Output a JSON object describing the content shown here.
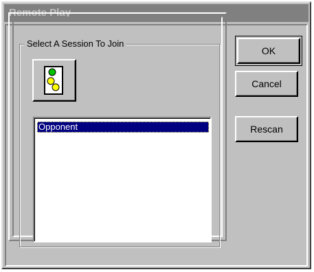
{
  "window": {
    "title": "Remote Play"
  },
  "session_group": {
    "label": "Select A Session To Join",
    "refresh_icon": "traffic-light-icon",
    "sessions": [
      {
        "name": "Opponent",
        "selected": true
      }
    ]
  },
  "buttons": {
    "ok": "OK",
    "cancel": "Cancel",
    "rescan": "Rescan"
  },
  "colors": {
    "face": "#c0c0c0",
    "title_inactive": "#808080",
    "selection": "#000080",
    "light_green": "#00c000",
    "light_yellow": "#ffff00"
  }
}
